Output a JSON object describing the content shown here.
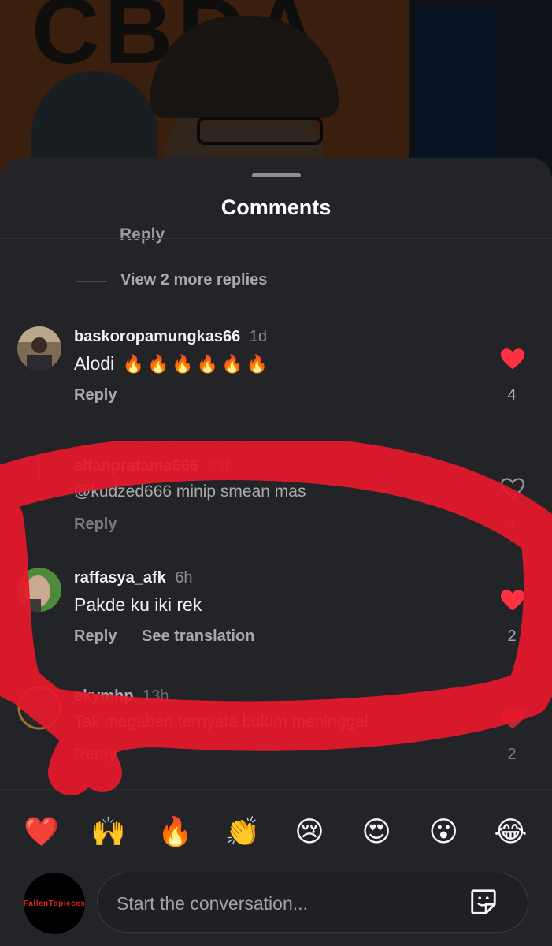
{
  "header": {
    "title": "Comments"
  },
  "thread": {
    "partial_reply_label": "Reply",
    "view_more_label": "View 2 more replies"
  },
  "comments": [
    {
      "username": "baskoropamungkas66",
      "time": "1d",
      "text": "Alodi",
      "reply_label": "Reply",
      "likes": "4",
      "liked": true
    },
    {
      "username": "alfanpratama666",
      "time": "23h",
      "text": "@kudzed666 minip smean mas",
      "reply_label": "Reply",
      "likes": "1",
      "liked": false
    },
    {
      "username": "raffasya_afk",
      "time": "6h",
      "text": "Pakde ku iki rek",
      "reply_label": "Reply",
      "translation_label": "See translation",
      "likes": "2",
      "liked": true
    },
    {
      "username": "ekymhp",
      "time": "13h",
      "text": "Tak megaben ternyata bulum meninggal",
      "reply_label": "Reply",
      "likes": "2",
      "liked": true
    }
  ],
  "emoji_bar": [
    "❤️",
    "🙌",
    "🔥",
    "👏",
    "😢",
    "😍",
    "😮",
    "😂"
  ],
  "composer": {
    "avatar_text": "FallenTopieces",
    "placeholder": "Start the conversation...",
    "sticker_icon": "sticker-icon"
  },
  "colors": {
    "like_red": "#ff3040",
    "sheet_bg": "#232428",
    "scribble": "#e8192c"
  }
}
